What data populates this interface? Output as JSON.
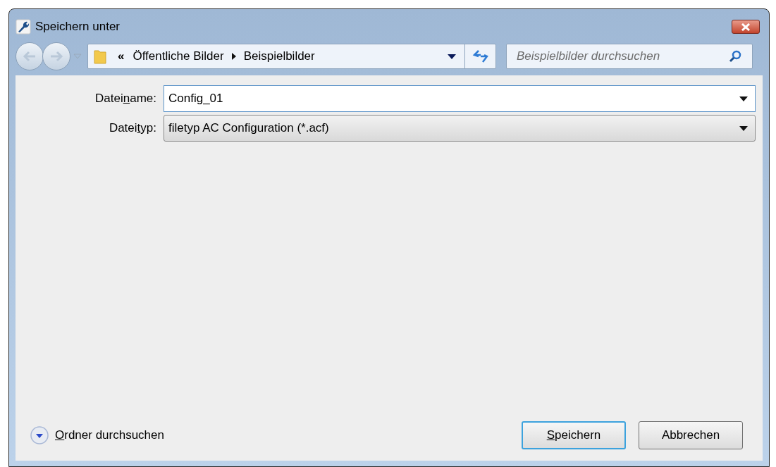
{
  "window": {
    "title": "Speichern unter"
  },
  "address_bar": {
    "overflow": "«",
    "path": [
      "Öffentliche Bilder",
      "Beispielbilder"
    ]
  },
  "search": {
    "placeholder": "Beispielbilder durchsuchen"
  },
  "fields": [
    {
      "kind": "combo-edit",
      "label": {
        "before": "Datei",
        "key": "n",
        "after": "ame:"
      },
      "value": "Config_01"
    },
    {
      "kind": "combo-select",
      "label": {
        "before": "Datei",
        "key": "t",
        "after": "yp:"
      },
      "value": "filetyp AC Configuration (*.acf)"
    }
  ],
  "browse_toggle": {
    "label": {
      "key": "O",
      "after": "rdner durchsuchen"
    },
    "expanded": false
  },
  "buttons": [
    {
      "label": {
        "key": "S",
        "after": "peichern"
      },
      "default": true
    },
    {
      "label": {
        "after": "Abbrechen"
      },
      "default": false
    }
  ]
}
